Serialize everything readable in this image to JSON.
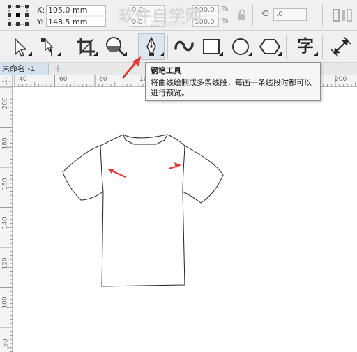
{
  "property_bar": {
    "x_label": "X:",
    "x_value": "105.0 mm",
    "y_label": "Y:",
    "y_value": "148.5 mm",
    "width_value": "0.0",
    "height_value": "0.0",
    "scale_w": "100.0",
    "scale_h": "100.0",
    "percent_symbol": "%",
    "rotation_value": ".0",
    "watermark": "软件自学网",
    "watermark_url": "RJZXW.COM"
  },
  "toolbox": {
    "tools": [
      {
        "name": "pick-tool",
        "icon": "arrow-pointer-icon"
      },
      {
        "name": "shape-tool",
        "icon": "shape-node-icon"
      },
      {
        "name": "crop-tool",
        "icon": "crop-icon"
      },
      {
        "name": "zoom-tool",
        "icon": "magnifier-icon"
      },
      {
        "name": "pen-tool",
        "icon": "pen-nib-icon",
        "active": true
      },
      {
        "name": "artistic-media-tool",
        "icon": "brush-stroke-icon"
      },
      {
        "name": "rectangle-tool",
        "icon": "rectangle-icon"
      },
      {
        "name": "ellipse-tool",
        "icon": "ellipse-icon"
      },
      {
        "name": "polygon-tool",
        "icon": "polygon-icon"
      },
      {
        "name": "text-tool",
        "icon": "text-zi-icon",
        "label": "字"
      },
      {
        "name": "dimension-tool",
        "icon": "dimension-icon"
      }
    ]
  },
  "document": {
    "tab_label": "未命名 -1",
    "add_tab": "+"
  },
  "ruler": {
    "top_ticks": [
      "40",
      "60",
      "80",
      "100",
      "200"
    ],
    "left_ticks": [
      "200",
      "180",
      "160",
      "140",
      "120",
      "100",
      "80"
    ]
  },
  "tooltip": {
    "title": "钢笔工具",
    "text": "将曲线绘制成多条线段，每画一条线段时都可以进行预览。"
  },
  "colors": {
    "accent_arrow": "#e53935",
    "active_tool_bg": "#dde6ef",
    "toolbar_bg": "#f0f0f0"
  }
}
